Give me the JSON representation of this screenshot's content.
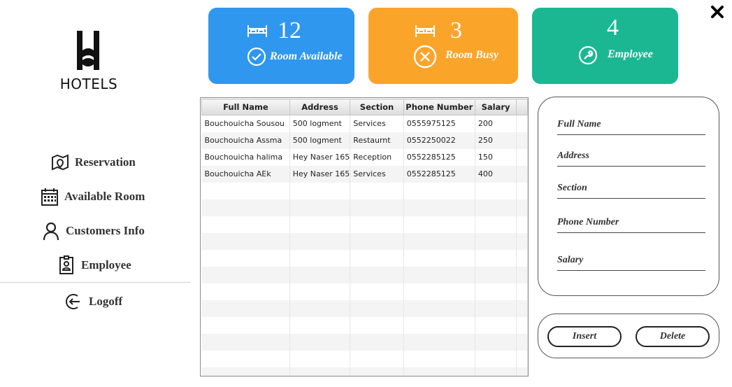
{
  "brand": {
    "logo_text": "HOTELS"
  },
  "nav": {
    "reservation": "Reservation",
    "available_room": "Available Room",
    "customers_info": "Customers Info",
    "employee": "Employee",
    "logoff": "Logoff"
  },
  "stats": {
    "available": {
      "count": "12",
      "label": "Room Available",
      "color": "#2f97ee",
      "icon": "bed-icon"
    },
    "busy": {
      "count": "3",
      "label": "Room Busy",
      "color": "#fba42a",
      "icon": "bed-icon"
    },
    "employee": {
      "count": "4",
      "label": "Employee",
      "color": "#1bb793",
      "icon": "wrench-icon"
    }
  },
  "table": {
    "headers": [
      "Full Name",
      "Address",
      "Section",
      "Phone Number",
      "Salary"
    ],
    "rows": [
      [
        "Bouchouicha Sousou",
        "500 logment",
        "Services",
        "0555975125",
        "200"
      ],
      [
        "Bouchouicha Assma",
        "500 logment",
        "Restaurnt",
        "0552250022",
        "250"
      ],
      [
        "Bouchouicha halima",
        "Hey Naser 165",
        "Reception",
        "0552285125",
        "150"
      ],
      [
        "Bouchouicha AEk",
        "Hey Naser 165",
        "Services",
        "0552285125",
        "400"
      ]
    ]
  },
  "form": {
    "full_name": "Full Name",
    "address": "Address",
    "section": "Section",
    "phone_number": "Phone Number",
    "salary": "Salary"
  },
  "buttons": {
    "insert": "Insert",
    "delete": "Delete"
  }
}
